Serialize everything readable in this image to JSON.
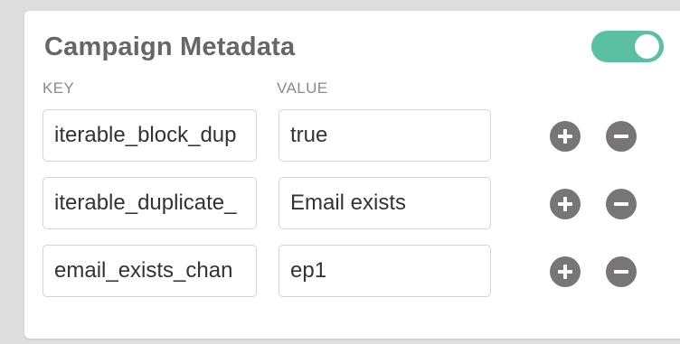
{
  "panel": {
    "title": "Campaign Metadata",
    "toggle_on": true,
    "toggle_color": "#5bc0a2"
  },
  "columns": {
    "key_header": "KEY",
    "value_header": "VALUE"
  },
  "rows": [
    {
      "key": "iterable_block_dup",
      "value": "true"
    },
    {
      "key": "iterable_duplicate_",
      "value": "Email exists"
    },
    {
      "key": "email_exists_chan",
      "value": "ep1"
    }
  ],
  "icons": {
    "add": "plus-circle-icon",
    "remove": "minus-circle-icon"
  },
  "colors": {
    "icon_button": "#777575",
    "title_text": "#666666"
  }
}
